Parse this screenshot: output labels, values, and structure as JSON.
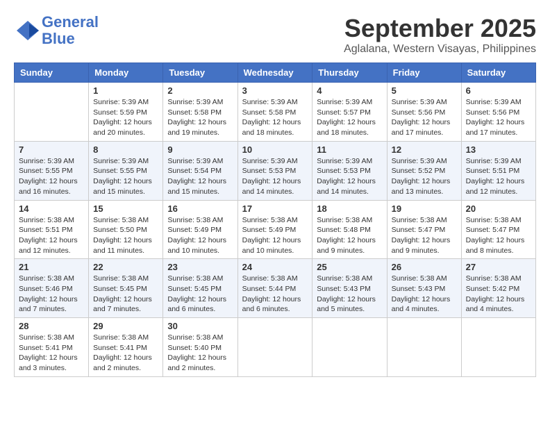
{
  "app": {
    "name": "GeneralBlue",
    "logo_text_part1": "General",
    "logo_text_part2": "Blue"
  },
  "calendar": {
    "month_year": "September 2025",
    "location": "Aglalana, Western Visayas, Philippines",
    "days_of_week": [
      "Sunday",
      "Monday",
      "Tuesday",
      "Wednesday",
      "Thursday",
      "Friday",
      "Saturday"
    ],
    "weeks": [
      [
        {
          "day": "",
          "info": ""
        },
        {
          "day": "1",
          "info": "Sunrise: 5:39 AM\nSunset: 5:59 PM\nDaylight: 12 hours\nand 20 minutes."
        },
        {
          "day": "2",
          "info": "Sunrise: 5:39 AM\nSunset: 5:58 PM\nDaylight: 12 hours\nand 19 minutes."
        },
        {
          "day": "3",
          "info": "Sunrise: 5:39 AM\nSunset: 5:58 PM\nDaylight: 12 hours\nand 18 minutes."
        },
        {
          "day": "4",
          "info": "Sunrise: 5:39 AM\nSunset: 5:57 PM\nDaylight: 12 hours\nand 18 minutes."
        },
        {
          "day": "5",
          "info": "Sunrise: 5:39 AM\nSunset: 5:56 PM\nDaylight: 12 hours\nand 17 minutes."
        },
        {
          "day": "6",
          "info": "Sunrise: 5:39 AM\nSunset: 5:56 PM\nDaylight: 12 hours\nand 17 minutes."
        }
      ],
      [
        {
          "day": "7",
          "info": "Sunrise: 5:39 AM\nSunset: 5:55 PM\nDaylight: 12 hours\nand 16 minutes."
        },
        {
          "day": "8",
          "info": "Sunrise: 5:39 AM\nSunset: 5:55 PM\nDaylight: 12 hours\nand 15 minutes."
        },
        {
          "day": "9",
          "info": "Sunrise: 5:39 AM\nSunset: 5:54 PM\nDaylight: 12 hours\nand 15 minutes."
        },
        {
          "day": "10",
          "info": "Sunrise: 5:39 AM\nSunset: 5:53 PM\nDaylight: 12 hours\nand 14 minutes."
        },
        {
          "day": "11",
          "info": "Sunrise: 5:39 AM\nSunset: 5:53 PM\nDaylight: 12 hours\nand 14 minutes."
        },
        {
          "day": "12",
          "info": "Sunrise: 5:39 AM\nSunset: 5:52 PM\nDaylight: 12 hours\nand 13 minutes."
        },
        {
          "day": "13",
          "info": "Sunrise: 5:39 AM\nSunset: 5:51 PM\nDaylight: 12 hours\nand 12 minutes."
        }
      ],
      [
        {
          "day": "14",
          "info": "Sunrise: 5:38 AM\nSunset: 5:51 PM\nDaylight: 12 hours\nand 12 minutes."
        },
        {
          "day": "15",
          "info": "Sunrise: 5:38 AM\nSunset: 5:50 PM\nDaylight: 12 hours\nand 11 minutes."
        },
        {
          "day": "16",
          "info": "Sunrise: 5:38 AM\nSunset: 5:49 PM\nDaylight: 12 hours\nand 10 minutes."
        },
        {
          "day": "17",
          "info": "Sunrise: 5:38 AM\nSunset: 5:49 PM\nDaylight: 12 hours\nand 10 minutes."
        },
        {
          "day": "18",
          "info": "Sunrise: 5:38 AM\nSunset: 5:48 PM\nDaylight: 12 hours\nand 9 minutes."
        },
        {
          "day": "19",
          "info": "Sunrise: 5:38 AM\nSunset: 5:47 PM\nDaylight: 12 hours\nand 9 minutes."
        },
        {
          "day": "20",
          "info": "Sunrise: 5:38 AM\nSunset: 5:47 PM\nDaylight: 12 hours\nand 8 minutes."
        }
      ],
      [
        {
          "day": "21",
          "info": "Sunrise: 5:38 AM\nSunset: 5:46 PM\nDaylight: 12 hours\nand 7 minutes."
        },
        {
          "day": "22",
          "info": "Sunrise: 5:38 AM\nSunset: 5:45 PM\nDaylight: 12 hours\nand 7 minutes."
        },
        {
          "day": "23",
          "info": "Sunrise: 5:38 AM\nSunset: 5:45 PM\nDaylight: 12 hours\nand 6 minutes."
        },
        {
          "day": "24",
          "info": "Sunrise: 5:38 AM\nSunset: 5:44 PM\nDaylight: 12 hours\nand 6 minutes."
        },
        {
          "day": "25",
          "info": "Sunrise: 5:38 AM\nSunset: 5:43 PM\nDaylight: 12 hours\nand 5 minutes."
        },
        {
          "day": "26",
          "info": "Sunrise: 5:38 AM\nSunset: 5:43 PM\nDaylight: 12 hours\nand 4 minutes."
        },
        {
          "day": "27",
          "info": "Sunrise: 5:38 AM\nSunset: 5:42 PM\nDaylight: 12 hours\nand 4 minutes."
        }
      ],
      [
        {
          "day": "28",
          "info": "Sunrise: 5:38 AM\nSunset: 5:41 PM\nDaylight: 12 hours\nand 3 minutes."
        },
        {
          "day": "29",
          "info": "Sunrise: 5:38 AM\nSunset: 5:41 PM\nDaylight: 12 hours\nand 2 minutes."
        },
        {
          "day": "30",
          "info": "Sunrise: 5:38 AM\nSunset: 5:40 PM\nDaylight: 12 hours\nand 2 minutes."
        },
        {
          "day": "",
          "info": ""
        },
        {
          "day": "",
          "info": ""
        },
        {
          "day": "",
          "info": ""
        },
        {
          "day": "",
          "info": ""
        }
      ]
    ]
  }
}
